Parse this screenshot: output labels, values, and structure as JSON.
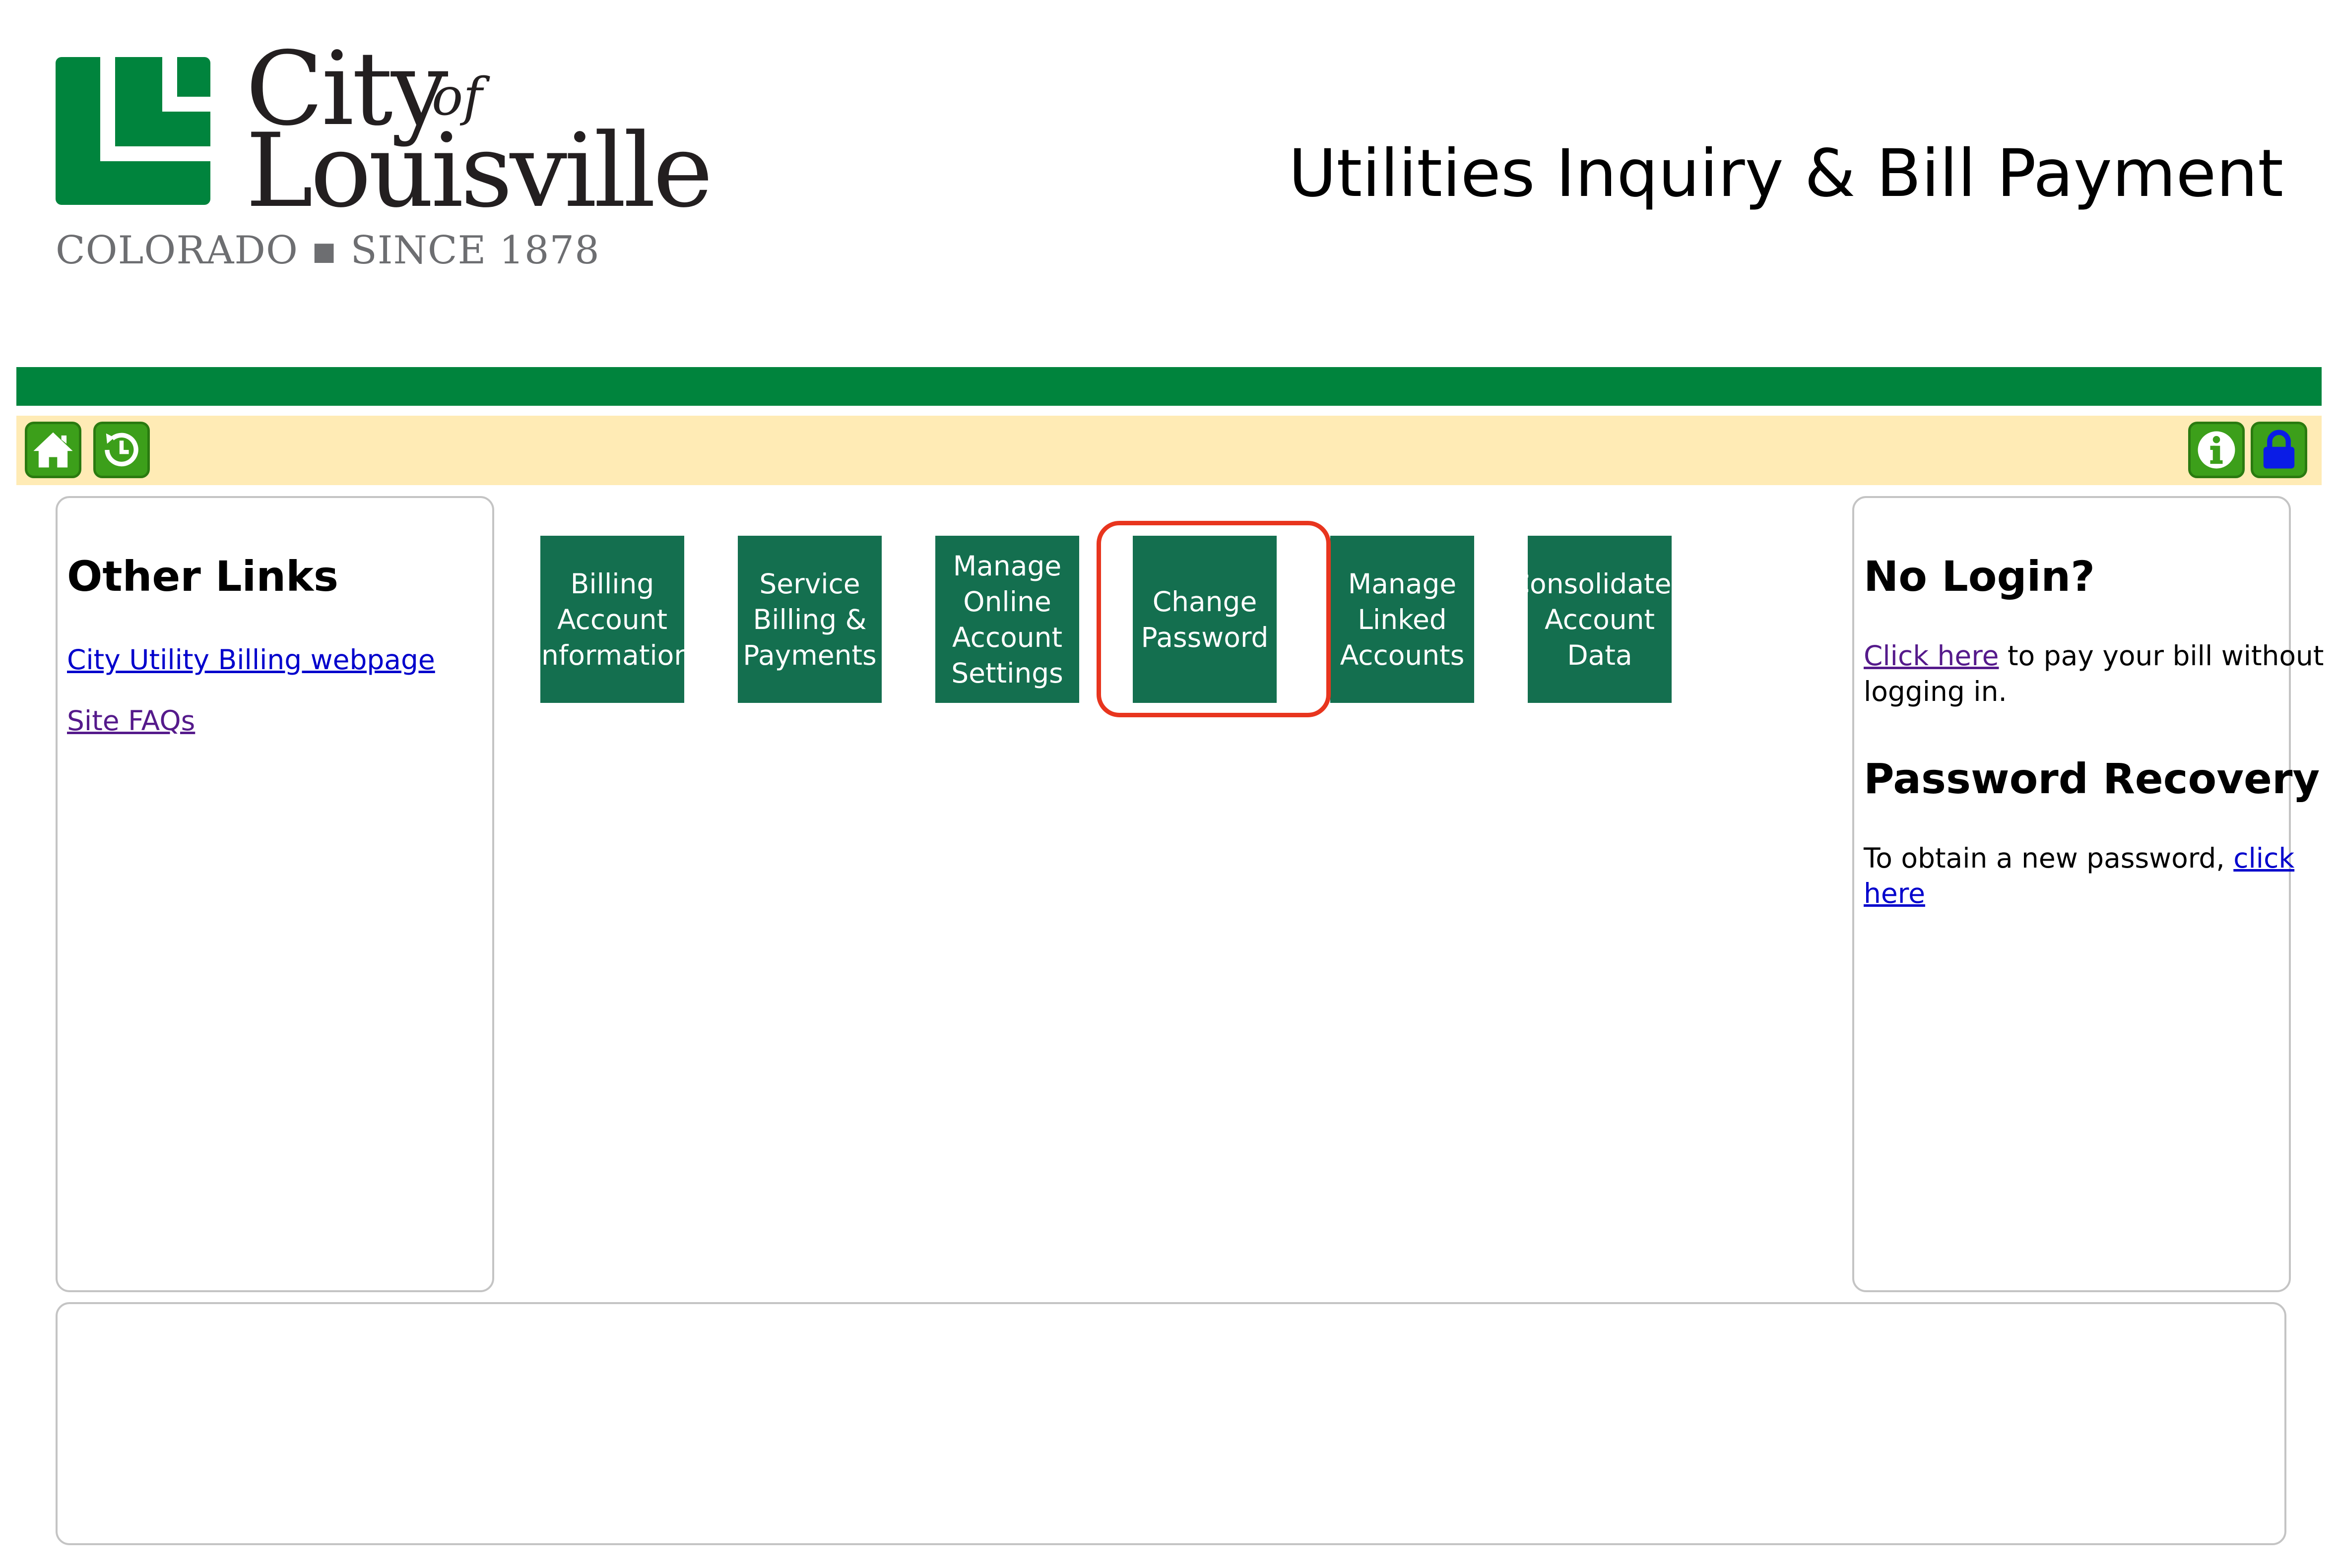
{
  "logo": {
    "city": "City",
    "of": "of",
    "name": "Louisville",
    "tagline": "COLORADO ▪ SINCE 1878"
  },
  "header": {
    "title": "Utilities Inquiry & Bill Payment"
  },
  "toolbar": {
    "left_icons": [
      "home-icon",
      "history-icon"
    ],
    "right_icons": [
      "info-icon",
      "lock-icon"
    ]
  },
  "left_panel": {
    "heading": "Other Links",
    "links": [
      {
        "label": "City Utility Billing webpage"
      },
      {
        "label": "Site FAQs"
      }
    ]
  },
  "tiles": [
    {
      "label": "Billing\nAccount\nInformation"
    },
    {
      "label": "Service\nBilling &\nPayments"
    },
    {
      "label": "Manage\nOnline\nAccount\nSettings"
    },
    {
      "label": "Change\nPassword"
    },
    {
      "label": "Manage\nLinked\nAccounts"
    },
    {
      "label": "Consolidated\nAccount\nData"
    }
  ],
  "right_panel": {
    "no_login_heading": "No Login?",
    "no_login_link": "Click here",
    "no_login_text_1": " to pay your bill without",
    "no_login_text_2": "logging in.",
    "recovery_heading": "Password Recovery",
    "recovery_text": "To obtain a new password, ",
    "recovery_link_1": "click",
    "recovery_link_2": "here"
  },
  "colors": {
    "brand_green": "#00843d",
    "tile_green": "#146f4f",
    "toolbar_bg": "#ffebb5",
    "highlight": "#e8351e"
  }
}
